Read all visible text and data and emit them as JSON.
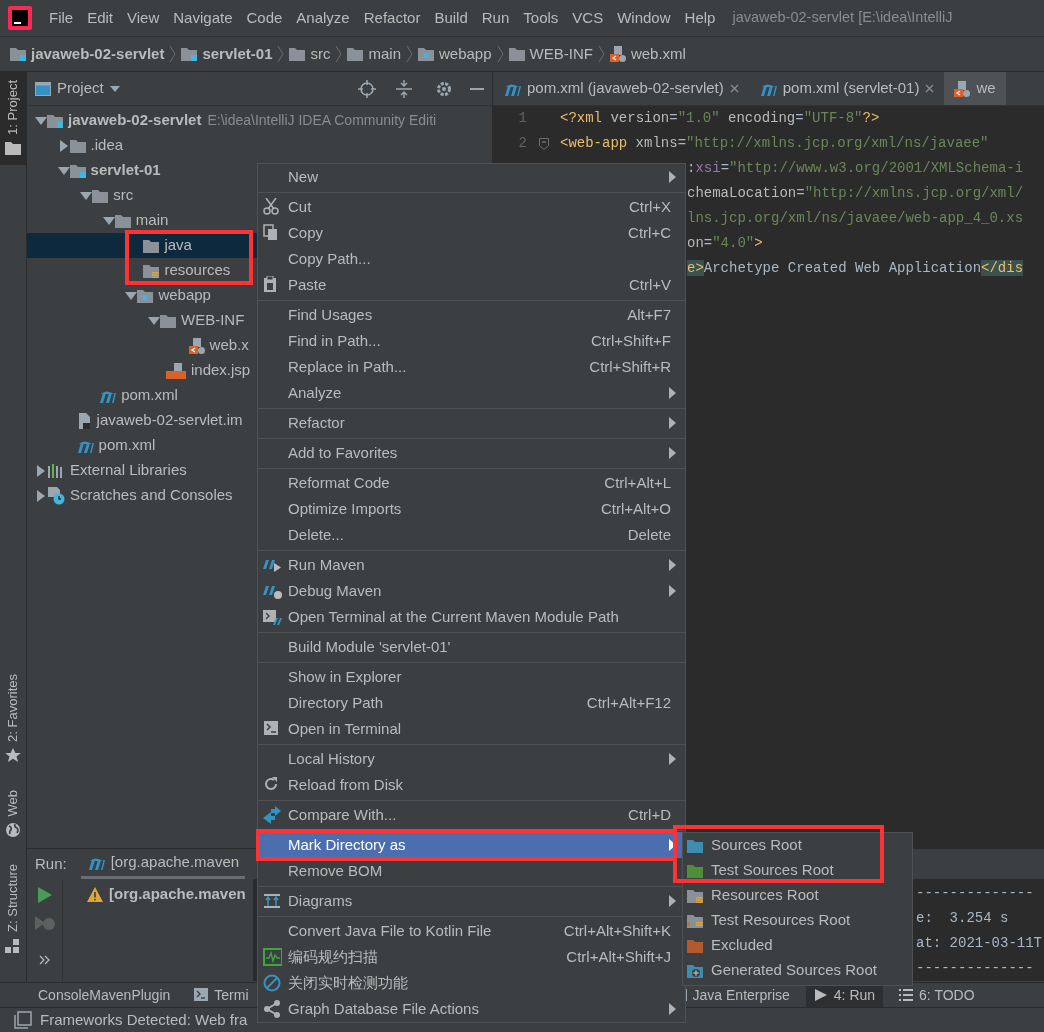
{
  "menubar": {
    "items": [
      "File",
      "Edit",
      "View",
      "Navigate",
      "Code",
      "Analyze",
      "Refactor",
      "Build",
      "Run",
      "Tools",
      "VCS",
      "Window",
      "Help"
    ],
    "title": "javaweb-02-servlet [E:\\idea\\IntelliJ"
  },
  "breadcrumbs": [
    {
      "label": "javaweb-02-servlet",
      "kind": "module"
    },
    {
      "label": "servlet-01",
      "kind": "module"
    },
    {
      "label": "src",
      "kind": "folder"
    },
    {
      "label": "main",
      "kind": "folder"
    },
    {
      "label": "webapp",
      "kind": "web"
    },
    {
      "label": "WEB-INF",
      "kind": "folder"
    },
    {
      "label": "web.xml",
      "kind": "xml"
    }
  ],
  "left_toolstrip": {
    "top": [
      {
        "label": "1: Project",
        "kind": "folder",
        "selected": true
      }
    ],
    "bottom": [
      {
        "label": "2: Favorites",
        "kind": "star",
        "selected": false
      },
      {
        "label": "Web",
        "kind": "globe",
        "selected": false
      },
      {
        "label": "Z: Structure",
        "kind": "structure",
        "selected": false
      }
    ]
  },
  "project_panel": {
    "title": "Project",
    "tree": [
      {
        "label": "javaweb-02-servlet",
        "hint": "E:\\idea\\IntelliJ IDEA Community Editi",
        "kind": "module",
        "expanded": true,
        "selected": false,
        "children": [
          {
            "label": ".idea",
            "kind": "folder",
            "expanded": false,
            "selected": false
          },
          {
            "label": "servlet-01",
            "kind": "module",
            "expanded": true,
            "selected": false,
            "children": [
              {
                "label": "src",
                "kind": "folder",
                "expanded": true,
                "selected": false,
                "children": [
                  {
                    "label": "main",
                    "kind": "folder",
                    "expanded": true,
                    "selected": false,
                    "children": [
                      {
                        "label": "java",
                        "kind": "folder",
                        "selected": true,
                        "highlighted": true
                      },
                      {
                        "label": "resources",
                        "kind": "resources",
                        "selected": false,
                        "highlighted": true
                      },
                      {
                        "label": "webapp",
                        "kind": "web",
                        "expanded": true,
                        "selected": false,
                        "children": [
                          {
                            "label": "WEB-INF",
                            "kind": "folder",
                            "expanded": true,
                            "selected": false,
                            "children": [
                              {
                                "label": "web.x",
                                "kind": "xml",
                                "selected": false
                              }
                            ]
                          },
                          {
                            "label": "index.jsp",
                            "kind": "jsp",
                            "selected": false
                          }
                        ]
                      }
                    ]
                  }
                ]
              },
              {
                "label": "pom.xml",
                "kind": "maven",
                "selected": false
              }
            ]
          },
          {
            "label": "javaweb-02-servlet.im",
            "kind": "iml",
            "selected": false
          },
          {
            "label": "pom.xml",
            "kind": "maven",
            "selected": false
          }
        ]
      },
      {
        "label": "External Libraries",
        "kind": "libraries",
        "expanded": false,
        "selected": false
      },
      {
        "label": "Scratches and Consoles",
        "kind": "scratches",
        "expanded": false,
        "selected": false
      }
    ]
  },
  "editor": {
    "tabs": [
      {
        "label": "pom.xml (javaweb-02-servlet)",
        "kind": "maven",
        "selected": false,
        "closable": true
      },
      {
        "label": "pom.xml (servlet-01)",
        "kind": "maven",
        "selected": false,
        "closable": true
      },
      {
        "label": "we",
        "kind": "xml",
        "selected": true,
        "closable": false
      }
    ],
    "lines": [
      {
        "number": "1",
        "kind": "full",
        "fold": false,
        "segments": [
          {
            "kind": "tag",
            "text": "<?xml "
          },
          {
            "kind": "attr",
            "text": "version"
          },
          {
            "kind": "plain",
            "text": "="
          },
          {
            "kind": "str",
            "text": "\"1.0\""
          },
          {
            "kind": "attr",
            "text": " encoding"
          },
          {
            "kind": "plain",
            "text": "="
          },
          {
            "kind": "str",
            "text": "\"UTF-8\""
          },
          {
            "kind": "tag",
            "text": "?>"
          }
        ]
      },
      {
        "number": "2",
        "kind": "full",
        "fold": true,
        "segments": [
          {
            "kind": "tag",
            "text": "<web-app"
          },
          {
            "kind": "attr",
            "text": " xmlns"
          },
          {
            "kind": "plain",
            "text": "="
          },
          {
            "kind": "str",
            "text": "\"http://xmlns.jcp.org/xml/ns/javaee\""
          }
        ]
      },
      {
        "kind": "clipped",
        "segments": [
          {
            "kind": "plain",
            "text": ":"
          },
          {
            "kind": "ns",
            "text": "xsi"
          },
          {
            "kind": "plain",
            "text": "="
          },
          {
            "kind": "str",
            "text": "\"http://www.w3.org/2001/XMLSchema-i"
          }
        ]
      },
      {
        "kind": "clipped",
        "segments": [
          {
            "kind": "attr",
            "text": "chemaLocation"
          },
          {
            "kind": "plain",
            "text": "="
          },
          {
            "kind": "str",
            "text": "\"http://xmlns.jcp.org/xml/"
          }
        ]
      },
      {
        "kind": "clipped",
        "segments": [
          {
            "kind": "str",
            "text": "lns.jcp.org/xml/ns/javaee/web-app_4_0.xs"
          }
        ]
      },
      {
        "kind": "clipped",
        "segments": [
          {
            "kind": "attr",
            "text": "on"
          },
          {
            "kind": "plain",
            "text": "="
          },
          {
            "kind": "str",
            "text": "\"4.0\""
          },
          {
            "kind": "tag",
            "text": ">"
          }
        ]
      },
      {
        "kind": "clipped",
        "segments": [
          {
            "kind": "match",
            "text": "e>"
          },
          {
            "kind": "plain",
            "text": "Archetype Created Web Application"
          },
          {
            "kind": "match",
            "text": "</dis"
          }
        ]
      }
    ]
  },
  "run_panel": {
    "label": "Run:",
    "tab": "[org.apache.maven",
    "rows": [
      {
        "kind": "warning",
        "text": "[org.apache.maven"
      }
    ],
    "console": [
      "--------------",
      "e:  3.254 s",
      "at: 2021-03-11T",
      "--------------"
    ]
  },
  "bottom_tabs": [
    {
      "label": "ConsoleMavenPlugin",
      "kind": "none",
      "selected": false
    },
    {
      "label": "Termi",
      "kind": "terminal",
      "selected": false
    },
    {
      "label": "Java Enterprise",
      "kind": "enterprise",
      "selected": false
    },
    {
      "label": "4: Run",
      "kind": "run",
      "selected": true
    },
    {
      "label": "6: TODO",
      "kind": "todo",
      "selected": false
    }
  ],
  "status_bar": {
    "text": "Frameworks Detected: Web fra"
  },
  "context_menu": {
    "items": [
      {
        "kind": "item",
        "label": "New",
        "submenu": true,
        "selected": false
      },
      {
        "kind": "separator"
      },
      {
        "kind": "item",
        "label": "Cut",
        "shortcut": "Ctrl+X",
        "selected": false
      },
      {
        "kind": "item",
        "label": "Copy",
        "shortcut": "Ctrl+C",
        "selected": false
      },
      {
        "kind": "item",
        "label": "Copy Path...",
        "selected": false
      },
      {
        "kind": "item",
        "label": "Paste",
        "shortcut": "Ctrl+V",
        "selected": false
      },
      {
        "kind": "separator"
      },
      {
        "kind": "item",
        "label": "Find Usages",
        "shortcut": "Alt+F7",
        "selected": false
      },
      {
        "kind": "item",
        "label": "Find in Path...",
        "shortcut": "Ctrl+Shift+F",
        "selected": false
      },
      {
        "kind": "item",
        "label": "Replace in Path...",
        "shortcut": "Ctrl+Shift+R",
        "selected": false
      },
      {
        "kind": "item",
        "label": "Analyze",
        "submenu": true,
        "selected": false
      },
      {
        "kind": "separator"
      },
      {
        "kind": "item",
        "label": "Refactor",
        "submenu": true,
        "selected": false
      },
      {
        "kind": "separator"
      },
      {
        "kind": "item",
        "label": "Add to Favorites",
        "submenu": true,
        "selected": false
      },
      {
        "kind": "separator"
      },
      {
        "kind": "item",
        "label": "Reformat Code",
        "shortcut": "Ctrl+Alt+L",
        "selected": false
      },
      {
        "kind": "item",
        "label": "Optimize Imports",
        "shortcut": "Ctrl+Alt+O",
        "selected": false
      },
      {
        "kind": "item",
        "label": "Delete...",
        "shortcut": "Delete",
        "selected": false
      },
      {
        "kind": "separator"
      },
      {
        "kind": "item",
        "label": "Run Maven",
        "submenu": true,
        "selected": false
      },
      {
        "kind": "item",
        "label": "Debug Maven",
        "submenu": true,
        "selected": false
      },
      {
        "kind": "item",
        "label": "Open Terminal at the Current Maven Module Path",
        "selected": false
      },
      {
        "kind": "separator"
      },
      {
        "kind": "item",
        "label": "Build Module 'servlet-01'",
        "selected": false
      },
      {
        "kind": "separator"
      },
      {
        "kind": "item",
        "label": "Show in Explorer",
        "selected": false
      },
      {
        "kind": "item",
        "label": "Directory Path",
        "shortcut": "Ctrl+Alt+F12",
        "selected": false
      },
      {
        "kind": "item",
        "label": "Open in Terminal",
        "selected": false
      },
      {
        "kind": "separator"
      },
      {
        "kind": "item",
        "label": "Local History",
        "submenu": true,
        "selected": false
      },
      {
        "kind": "item",
        "label": "Reload from Disk",
        "selected": false
      },
      {
        "kind": "separator"
      },
      {
        "kind": "item",
        "label": "Compare With...",
        "shortcut": "Ctrl+D",
        "selected": false
      },
      {
        "kind": "separator"
      },
      {
        "kind": "item",
        "label": "Mark Directory as",
        "submenu": true,
        "selected": true,
        "highlighted": true
      },
      {
        "kind": "item",
        "label": "Remove BOM",
        "selected": false
      },
      {
        "kind": "separator"
      },
      {
        "kind": "item",
        "label": "Diagrams",
        "submenu": true,
        "selected": false
      },
      {
        "kind": "separator"
      },
      {
        "kind": "item",
        "label": "Convert Java File to Kotlin File",
        "shortcut": "Ctrl+Alt+Shift+K",
        "selected": false
      },
      {
        "kind": "item",
        "label": "编码规约扫描",
        "shortcut": "Ctrl+Alt+Shift+J",
        "selected": false
      },
      {
        "kind": "item",
        "label": "关闭实时检测功能",
        "selected": false
      },
      {
        "kind": "item",
        "label": "Graph Database File Actions",
        "submenu": true,
        "selected": false
      }
    ]
  },
  "submenu": {
    "items": [
      {
        "label": "Sources Root",
        "kind": "folder",
        "color": "#3c8db0",
        "highlighted": true
      },
      {
        "label": "Test Sources Root",
        "kind": "folder",
        "color": "#4f8f3a",
        "highlighted": true
      },
      {
        "label": "Resources Root",
        "kind": "resources",
        "color": "#8a9199",
        "highlighted": false
      },
      {
        "label": "Test Resources Root",
        "kind": "test-resources",
        "color": "#8a9199",
        "highlighted": false
      },
      {
        "label": "Excluded",
        "kind": "folder",
        "color": "#b05a2e",
        "highlighted": false
      },
      {
        "label": "Generated Sources Root",
        "kind": "generated",
        "color": "#3c8db0",
        "highlighted": false
      }
    ]
  }
}
